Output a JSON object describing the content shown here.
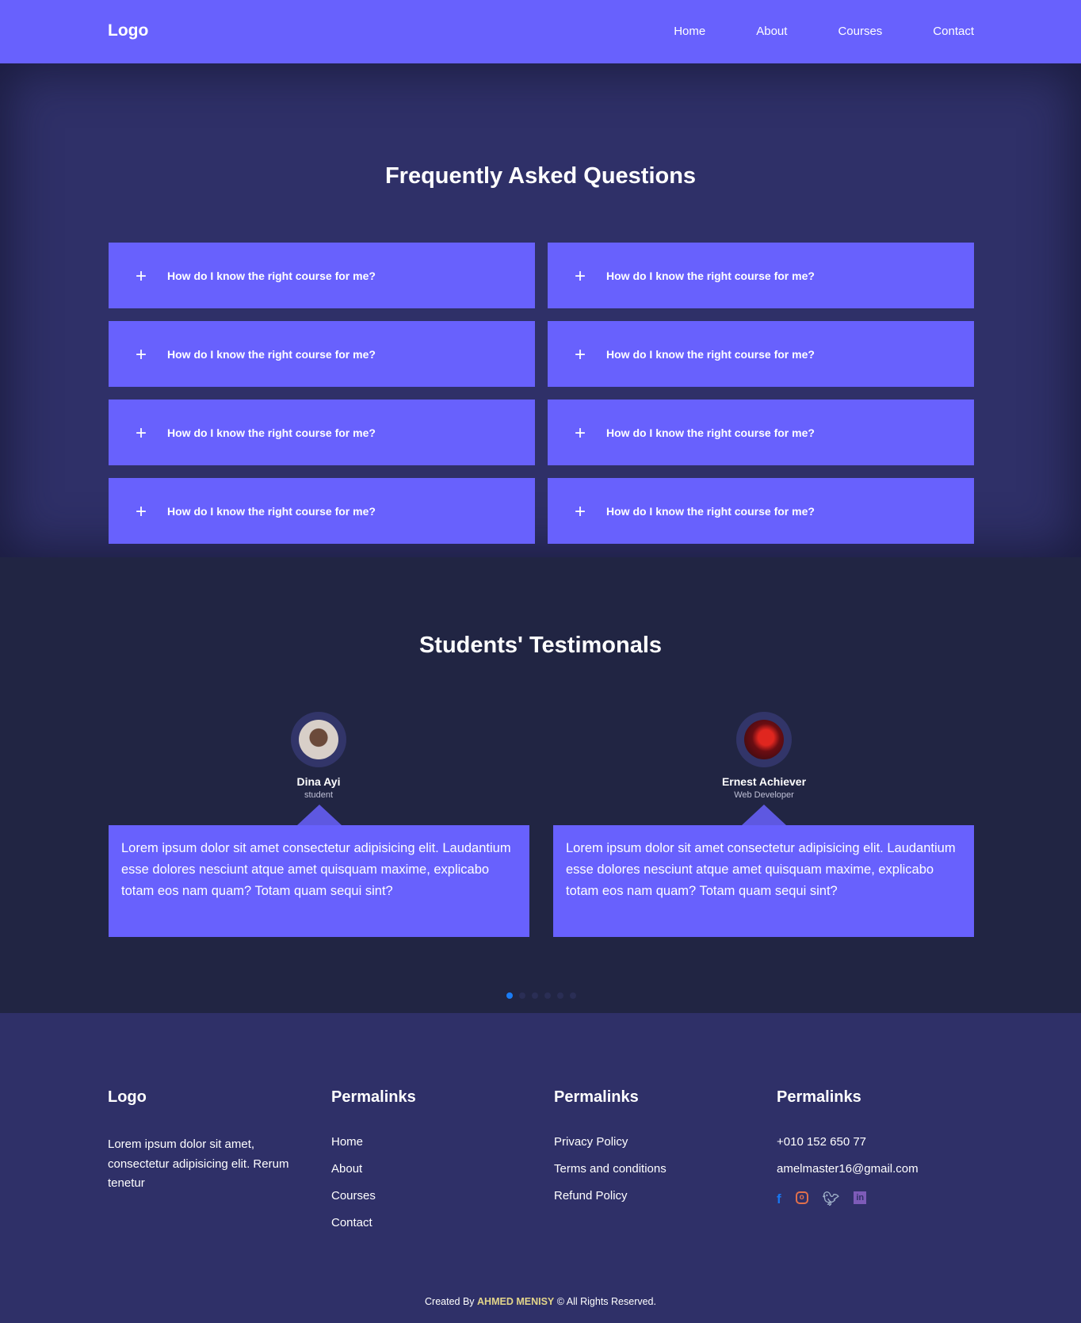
{
  "header": {
    "logo": "Logo",
    "nav": [
      "Home",
      "About",
      "Courses",
      "Contact"
    ]
  },
  "faq": {
    "title": "Frequently Asked Questions",
    "items": [
      "How do I know the right course for me?",
      "How do I know the right course for me?",
      "How do I know the right course for me?",
      "How do I know the right course for me?",
      "How do I know the right course for me?",
      "How do I know the right course for me?",
      "How do I know the right course for me?",
      "How do I know the right course for me?"
    ],
    "icon": "+"
  },
  "testimonials": {
    "title": "Students' Testimonals",
    "people": [
      {
        "name": "Dina Ayi",
        "role": "student",
        "text": "Lorem ipsum dolor sit amet consectetur adipisicing elit. Laudantium esse dolores nesciunt atque amet quisquam maxime, explicabo totam eos nam quam? Totam quam sequi sint?"
      },
      {
        "name": "Ernest Achiever",
        "role": "Web Developer",
        "text": "Lorem ipsum dolor sit amet consectetur adipisicing elit. Laudantium esse dolores nesciunt atque amet quisquam maxime, explicabo totam eos nam quam? Totam quam sequi sint?"
      }
    ],
    "pages": 6,
    "active_page": 1
  },
  "footer": {
    "logo": "Logo",
    "about": "Lorem ipsum dolor sit amet, consectetur adipisicing elit. Rerum tenetur",
    "col2": {
      "title": "Permalinks",
      "links": [
        "Home",
        "About",
        "Courses",
        "Contact"
      ]
    },
    "col3": {
      "title": "Permalinks",
      "links": [
        "Privacy Policy",
        "Terms and conditions",
        "Refund Policy"
      ]
    },
    "col4": {
      "title": "Permalinks",
      "phone": "+010 152 650 77",
      "email": "amelmaster16@gmail.com",
      "social": [
        "facebook-icon",
        "instagram-icon",
        "twitter-icon",
        "linkedin-icon"
      ]
    },
    "copy_pre": "Created By",
    "copy_name": "AHMED MENISY",
    "copy_post": "© All Rights Reserved."
  },
  "colors": {
    "accent": "#6861fd",
    "faq_bg": "#2f3068",
    "testimonials_bg": "#212543",
    "dot_active": "#1a7cf5",
    "author": "#e3d58a"
  }
}
